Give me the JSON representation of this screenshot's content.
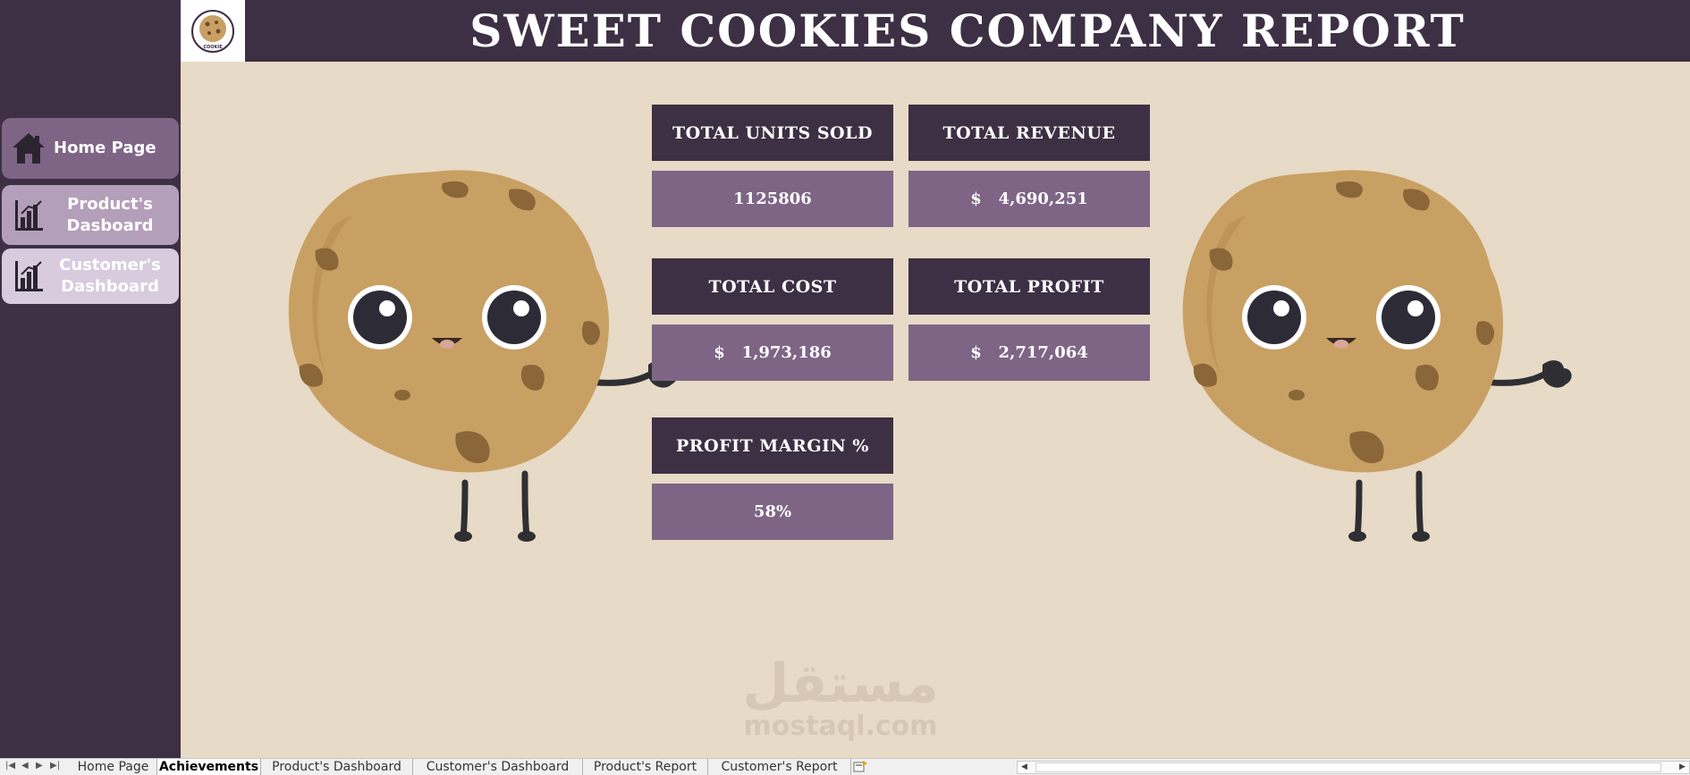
{
  "header": {
    "title": "Sweet Cookies Company Report",
    "logo_text": "COOKIE"
  },
  "sidebar": {
    "items": [
      {
        "label": "Home Page",
        "icon": "home-icon"
      },
      {
        "label": "Product's Dasboard",
        "icon": "bar-chart-icon"
      },
      {
        "label": "Customer's Dashboard",
        "icon": "bar-chart-icon"
      }
    ]
  },
  "kpis": {
    "units_sold": {
      "label": "Total Units Sold",
      "value": "1125806"
    },
    "revenue": {
      "label": "Total Revenue",
      "value": "$   4,690,251"
    },
    "cost": {
      "label": "Total Cost",
      "value": "$   1,973,186"
    },
    "profit": {
      "label": "Total Profit",
      "value": "$   2,717,064"
    },
    "margin": {
      "label": "Profit Margin %",
      "value": "58%"
    }
  },
  "watermark": {
    "arabic": "مستقل",
    "latin": "mostaql.com"
  },
  "sheet_tabs": {
    "items": [
      "Home Page",
      "Achievements",
      "Product's Dashboard",
      "Customer's Dashboard",
      "Product's Report",
      "Customer's Report"
    ],
    "active": "Achievements"
  },
  "colors": {
    "dark_purple": "#3e3044",
    "mid_purple": "#7e6586",
    "background": "#e7dac6",
    "cookie": "#c9a063"
  }
}
